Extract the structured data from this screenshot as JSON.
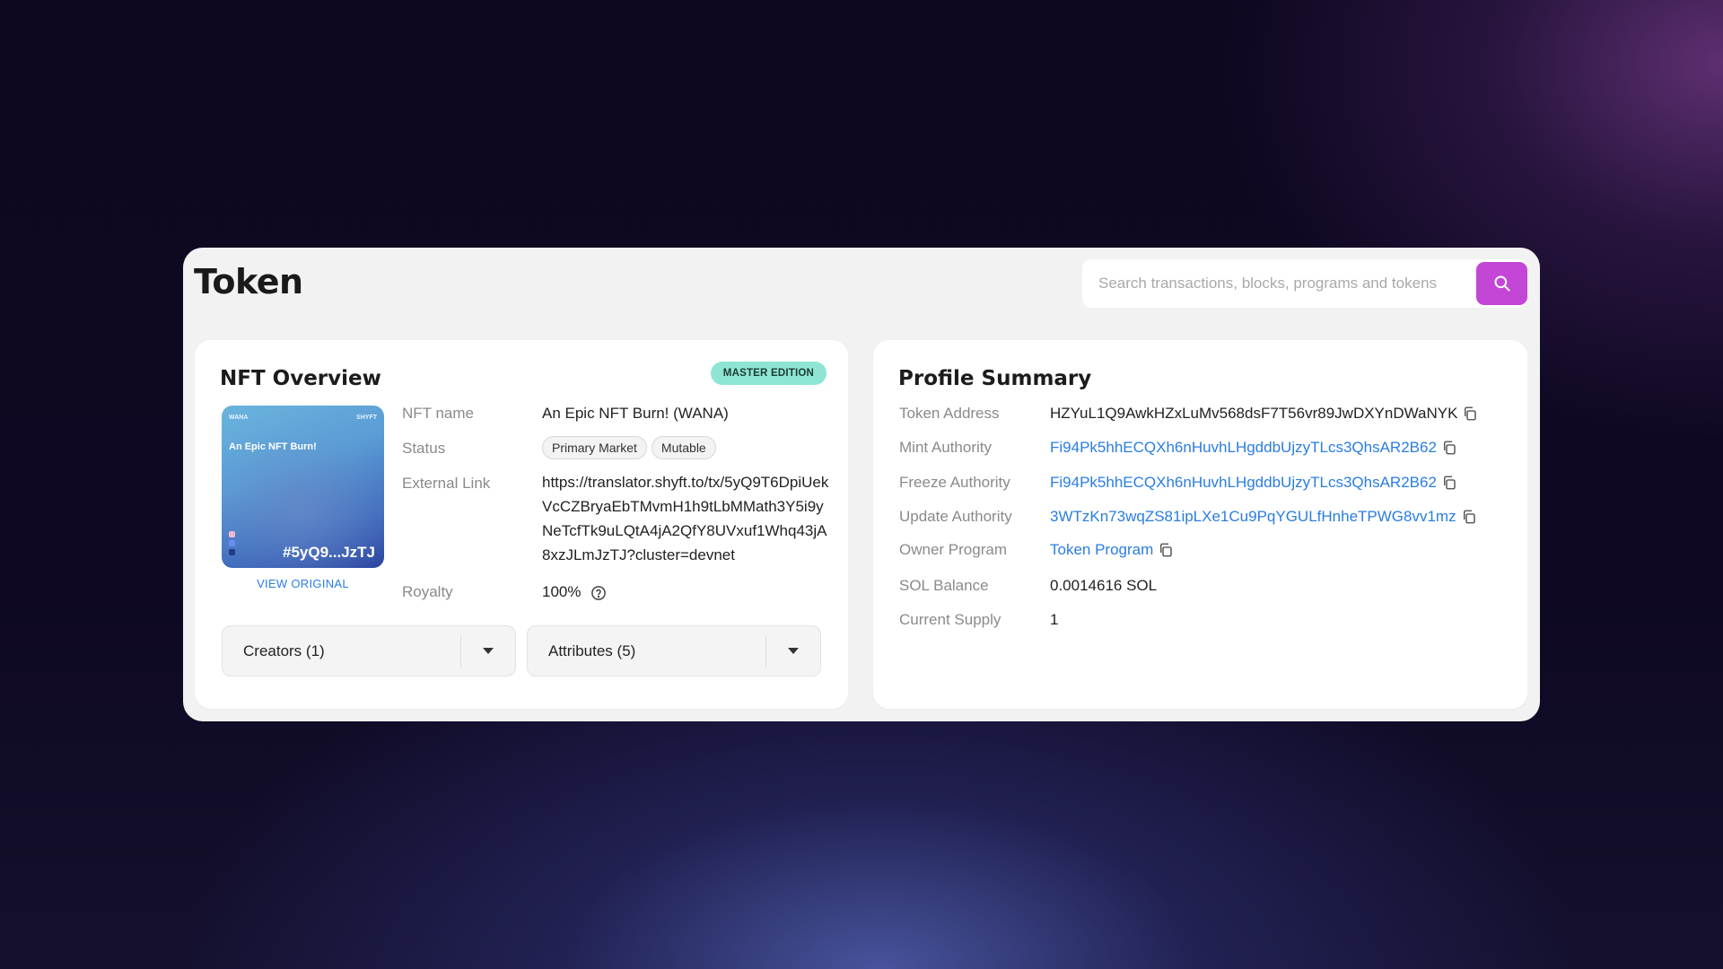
{
  "page": {
    "title": "Token"
  },
  "search": {
    "placeholder": "Search transactions, blocks, programs and tokens"
  },
  "nft_overview": {
    "title": "NFT Overview",
    "badge": "MASTER EDITION",
    "image": {
      "top_left": "WANA",
      "top_right": "SHYFT",
      "name": "An Epic NFT Burn!",
      "code": "#5yQ9...JzTJ",
      "dot_colors": [
        "#f2b8d0",
        "#6d8cf0",
        "#233a8a"
      ]
    },
    "view_original": "VIEW ORIGINAL",
    "rows": {
      "nft_name": {
        "label": "NFT name",
        "value": "An Epic NFT Burn! (WANA)"
      },
      "status": {
        "label": "Status",
        "chips": [
          "Primary Market",
          "Mutable"
        ]
      },
      "external_link": {
        "label": "External Link",
        "value": "https://translator.shyft.to/tx/5yQ9T6DpiUekVcCZBryaEbTMvmH1h9tLbMMath3Y5i9yNeTcfTk9uLQtA4jA2QfY8UVxuf1Whq43jA8xzJLmJzTJ?cluster=devnet"
      },
      "royalty": {
        "label": "Royalty",
        "value": "100%"
      }
    },
    "creators_label": "Creators (1)",
    "attributes_label": "Attributes (5)"
  },
  "profile_summary": {
    "title": "Profile Summary",
    "token_address": {
      "label": "Token Address",
      "value": "HZYuL1Q9AwkHZxLuMv568dsF7T56vr89JwDXYnDWaNYK"
    },
    "mint_authority": {
      "label": "Mint Authority",
      "value": "Fi94Pk5hhECQXh6nHuvhLHgddbUjzyTLcs3QhsAR2B62"
    },
    "freeze_authority": {
      "label": "Freeze Authority",
      "value": "Fi94Pk5hhECQXh6nHuvhLHgddbUjzyTLcs3QhsAR2B62"
    },
    "update_authority": {
      "label": "Update Authority",
      "value": "3WTzKn73wqZS81ipLXe1Cu9PqYGULfHnheTPWG8vv1mz"
    },
    "owner_program": {
      "label": "Owner Program",
      "value": "Token Program"
    },
    "sol_balance": {
      "label": "SOL Balance",
      "value": "0.0014616 SOL"
    },
    "current_supply": {
      "label": "Current Supply",
      "value": "1"
    }
  },
  "colors": {
    "accent": "#c346d6",
    "link": "#2a7de1",
    "badge_bg": "#8ee5d3",
    "window_bg": "#f2f2f2",
    "page_bg": "#0e0820"
  }
}
